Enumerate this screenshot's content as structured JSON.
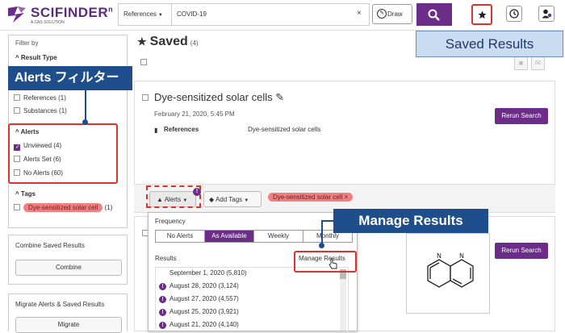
{
  "header": {
    "logo_text": "SCIFINDER",
    "logo_suffix": "n",
    "logo_sub": "A CAS SOLUTION",
    "scope": "References",
    "query": "COVID-19",
    "clear": "×",
    "draw": "Draw"
  },
  "sidebar": {
    "filter_by": "Filter by",
    "result_type": "Result Type",
    "references": "References (1)",
    "substances": "Substances (1)",
    "alerts_head": "Alerts",
    "unviewed": "Unviewed (4)",
    "alerts_set": "Alerts Set (6)",
    "no_alerts": "No Alerts (60)",
    "tags_head": "Tags",
    "tag": "Dye-sensitized solar cell",
    "tag_count": "(1)",
    "combine_title": "Combine Saved Results",
    "combine_btn": "Combine",
    "migrate_title": "Migrate Alerts & Saved Results",
    "migrate_btn": "Migrate"
  },
  "main": {
    "title": "Saved",
    "count": "(4)",
    "card": {
      "title": "Dye-sensitized solar cells",
      "date": "February 21, 2020, 5:45 PM",
      "type": "References",
      "query": "Dye-sensitized solar cells",
      "rerun": "Rerun Search"
    },
    "toolbar": {
      "alerts": "Alerts",
      "badge": "!",
      "add_tags": "Add Tags",
      "tag": "Dye-sensitized solar cell",
      "tag_x": "×"
    },
    "card2": {
      "rerun": "Rerun Search"
    }
  },
  "popup": {
    "frequency": "Frequency",
    "freq_options": [
      "No Alerts",
      "As Available",
      "Weekly",
      "Monthly"
    ],
    "results": "Results",
    "manage": "Manage Results",
    "items": [
      "September 1, 2020 (5,810)",
      "August 28, 2020 (3,124)",
      "August 27, 2020 (4,557)",
      "August 25, 2020 (3,921)",
      "August 21, 2020 (4,140)"
    ]
  },
  "callouts": {
    "saved_results": "Saved Results",
    "alerts_filter": "Alerts フィルター",
    "manage_results": "Manage Results"
  },
  "colors": {
    "brand": "#6b2d87",
    "callout": "#1f4e8c",
    "highlight": "#d9342b"
  }
}
